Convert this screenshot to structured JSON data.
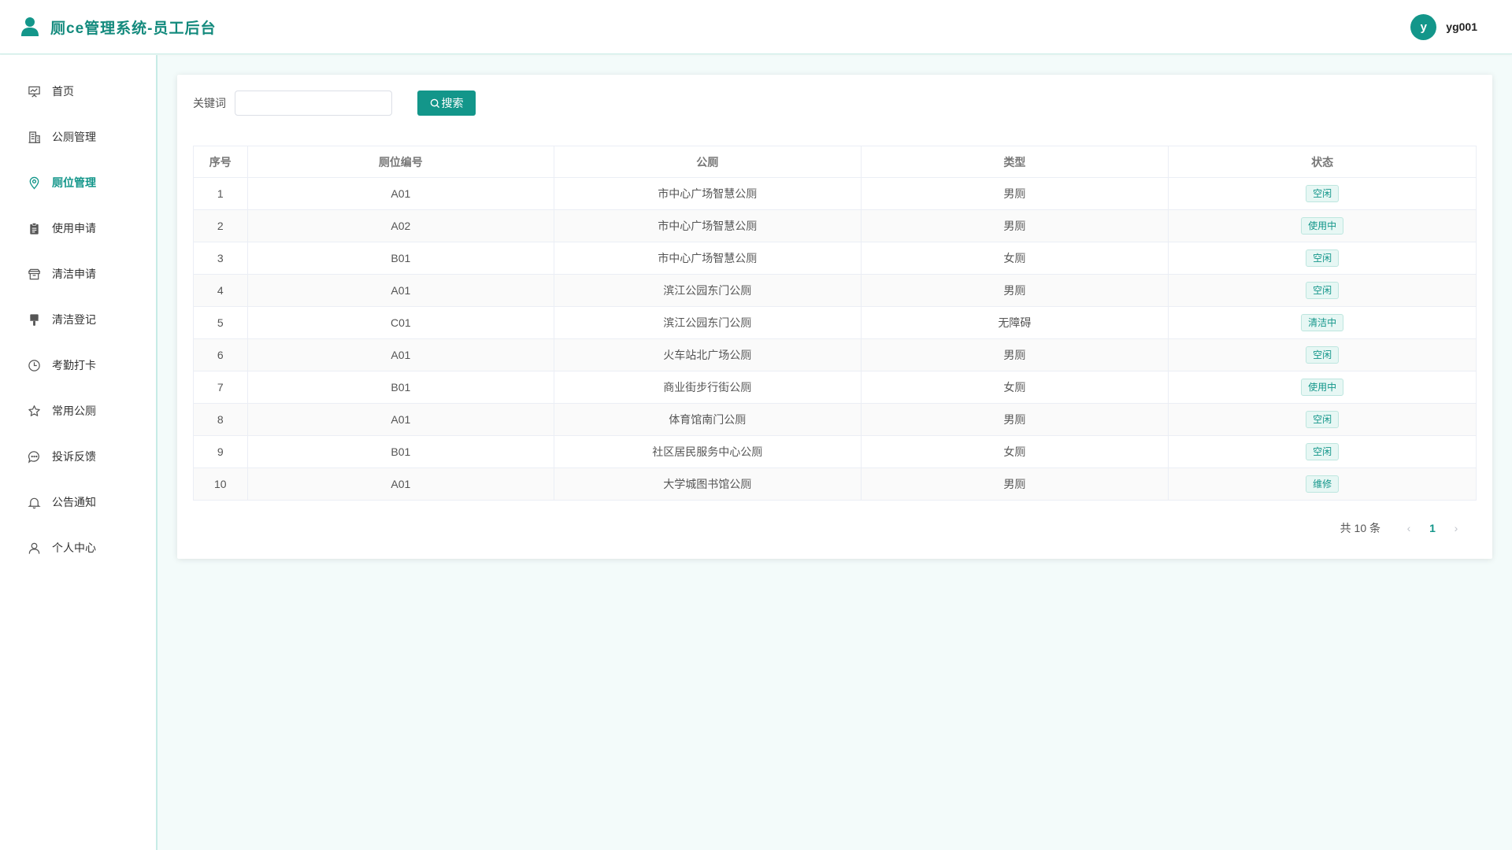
{
  "header": {
    "title": "厕ce管理系统-员工后台",
    "avatar_letter": "y",
    "username": "yg001"
  },
  "sidebar": {
    "items": [
      {
        "label": "首页",
        "icon": "presentation-icon",
        "active": false
      },
      {
        "label": "公厕管理",
        "icon": "building-icon",
        "active": false
      },
      {
        "label": "厕位管理",
        "icon": "location-pin-icon",
        "active": true
      },
      {
        "label": "使用申请",
        "icon": "clipboard-icon",
        "active": false
      },
      {
        "label": "清洁申请",
        "icon": "box-icon",
        "active": false
      },
      {
        "label": "清洁登记",
        "icon": "brush-icon",
        "active": false
      },
      {
        "label": "考勤打卡",
        "icon": "clock-icon",
        "active": false
      },
      {
        "label": "常用公厕",
        "icon": "star-icon",
        "active": false
      },
      {
        "label": "投诉反馈",
        "icon": "chat-bubble-icon",
        "active": false
      },
      {
        "label": "公告通知",
        "icon": "bell-icon",
        "active": false
      },
      {
        "label": "个人中心",
        "icon": "user-icon",
        "active": false
      }
    ]
  },
  "search": {
    "label": "关键词",
    "value": "",
    "placeholder": "",
    "button_label": "搜索"
  },
  "table": {
    "columns": [
      "序号",
      "厕位编号",
      "公厕",
      "类型",
      "状态"
    ],
    "rows": [
      {
        "index": "1",
        "code": "A01",
        "toilet": "市中心广场智慧公厕",
        "type": "男厕",
        "status": "空闲"
      },
      {
        "index": "2",
        "code": "A02",
        "toilet": "市中心广场智慧公厕",
        "type": "男厕",
        "status": "使用中"
      },
      {
        "index": "3",
        "code": "B01",
        "toilet": "市中心广场智慧公厕",
        "type": "女厕",
        "status": "空闲"
      },
      {
        "index": "4",
        "code": "A01",
        "toilet": "滨江公园东门公厕",
        "type": "男厕",
        "status": "空闲"
      },
      {
        "index": "5",
        "code": "C01",
        "toilet": "滨江公园东门公厕",
        "type": "无障碍",
        "status": "清洁中"
      },
      {
        "index": "6",
        "code": "A01",
        "toilet": "火车站北广场公厕",
        "type": "男厕",
        "status": "空闲"
      },
      {
        "index": "7",
        "code": "B01",
        "toilet": "商业街步行街公厕",
        "type": "女厕",
        "status": "使用中"
      },
      {
        "index": "8",
        "code": "A01",
        "toilet": "体育馆南门公厕",
        "type": "男厕",
        "status": "空闲"
      },
      {
        "index": "9",
        "code": "B01",
        "toilet": "社区居民服务中心公厕",
        "type": "女厕",
        "status": "空闲"
      },
      {
        "index": "10",
        "code": "A01",
        "toilet": "大学城图书馆公厕",
        "type": "男厕",
        "status": "维修"
      }
    ]
  },
  "pagination": {
    "total_text": "共 10 条",
    "current_page": "1",
    "prev_symbol": "‹",
    "next_symbol": "›"
  },
  "colors": {
    "accent": "#13968a",
    "tag_bg": "#e7f7f4",
    "tag_border": "#bde6df",
    "page_bg": "#f3fbfa"
  }
}
